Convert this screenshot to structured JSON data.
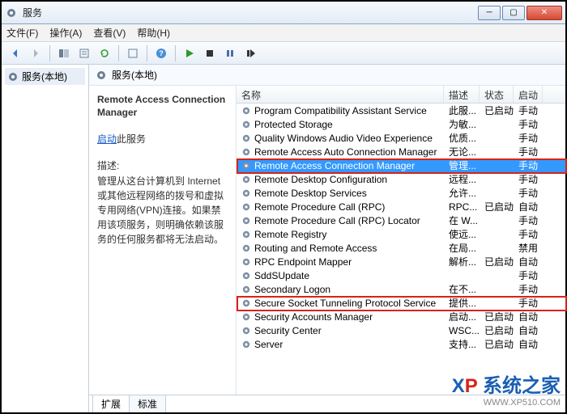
{
  "window": {
    "title": "服务"
  },
  "menu": {
    "file": "文件(F)",
    "action": "操作(A)",
    "view": "查看(V)",
    "help": "帮助(H)"
  },
  "tree": {
    "root": "服务(本地)"
  },
  "right_header": {
    "label": "服务(本地)"
  },
  "detail": {
    "title": "Remote Access Connection Manager",
    "start_link": "启动",
    "start_suffix": "此服务",
    "desc_label": "描述:",
    "desc_text": "管理从这台计算机到 Internet 或其他远程网络的拨号和虚拟专用网络(VPN)连接。如果禁用该项服务，则明确依赖该服务的任何服务都将无法启动。"
  },
  "columns": {
    "name": "名称",
    "desc": "描述",
    "status": "状态",
    "startup": "启动"
  },
  "tabs": {
    "extended": "扩展",
    "standard": "标准"
  },
  "rows": [
    {
      "name": "Program Compatibility Assistant Service",
      "desc": "此服...",
      "status": "已启动",
      "startup": "手动"
    },
    {
      "name": "Protected Storage",
      "desc": "为敏...",
      "status": "",
      "startup": "手动"
    },
    {
      "name": "Quality Windows Audio Video Experience",
      "desc": "优质...",
      "status": "",
      "startup": "手动"
    },
    {
      "name": "Remote Access Auto Connection Manager",
      "desc": "无论...",
      "status": "",
      "startup": "手动"
    },
    {
      "name": "Remote Access Connection Manager",
      "desc": "管理...",
      "status": "",
      "startup": "手动",
      "selected": true,
      "highlight": 1
    },
    {
      "name": "Remote Desktop Configuration",
      "desc": "远程...",
      "status": "",
      "startup": "手动"
    },
    {
      "name": "Remote Desktop Services",
      "desc": "允许...",
      "status": "",
      "startup": "手动"
    },
    {
      "name": "Remote Procedure Call (RPC)",
      "desc": "RPC...",
      "status": "已启动",
      "startup": "自动"
    },
    {
      "name": "Remote Procedure Call (RPC) Locator",
      "desc": "在 W...",
      "status": "",
      "startup": "手动"
    },
    {
      "name": "Remote Registry",
      "desc": "使远...",
      "status": "",
      "startup": "手动"
    },
    {
      "name": "Routing and Remote Access",
      "desc": "在局...",
      "status": "",
      "startup": "禁用"
    },
    {
      "name": "RPC Endpoint Mapper",
      "desc": "解析...",
      "status": "已启动",
      "startup": "自动"
    },
    {
      "name": "SddSUpdate",
      "desc": "",
      "status": "",
      "startup": "手动"
    },
    {
      "name": "Secondary Logon",
      "desc": "在不...",
      "status": "",
      "startup": "手动"
    },
    {
      "name": "Secure Socket Tunneling Protocol Service",
      "desc": "提供...",
      "status": "",
      "startup": "手动",
      "highlight": 2
    },
    {
      "name": "Security Accounts Manager",
      "desc": "启动...",
      "status": "已启动",
      "startup": "自动"
    },
    {
      "name": "Security Center",
      "desc": "WSC...",
      "status": "已启动",
      "startup": "自动"
    },
    {
      "name": "Server",
      "desc": "支持...",
      "status": "已启动",
      "startup": "自动"
    }
  ],
  "watermark": {
    "brand_a": "X",
    "brand_b": "P",
    "brand_suffix": "系统之家",
    "url": "WWW.XP510.COM"
  }
}
